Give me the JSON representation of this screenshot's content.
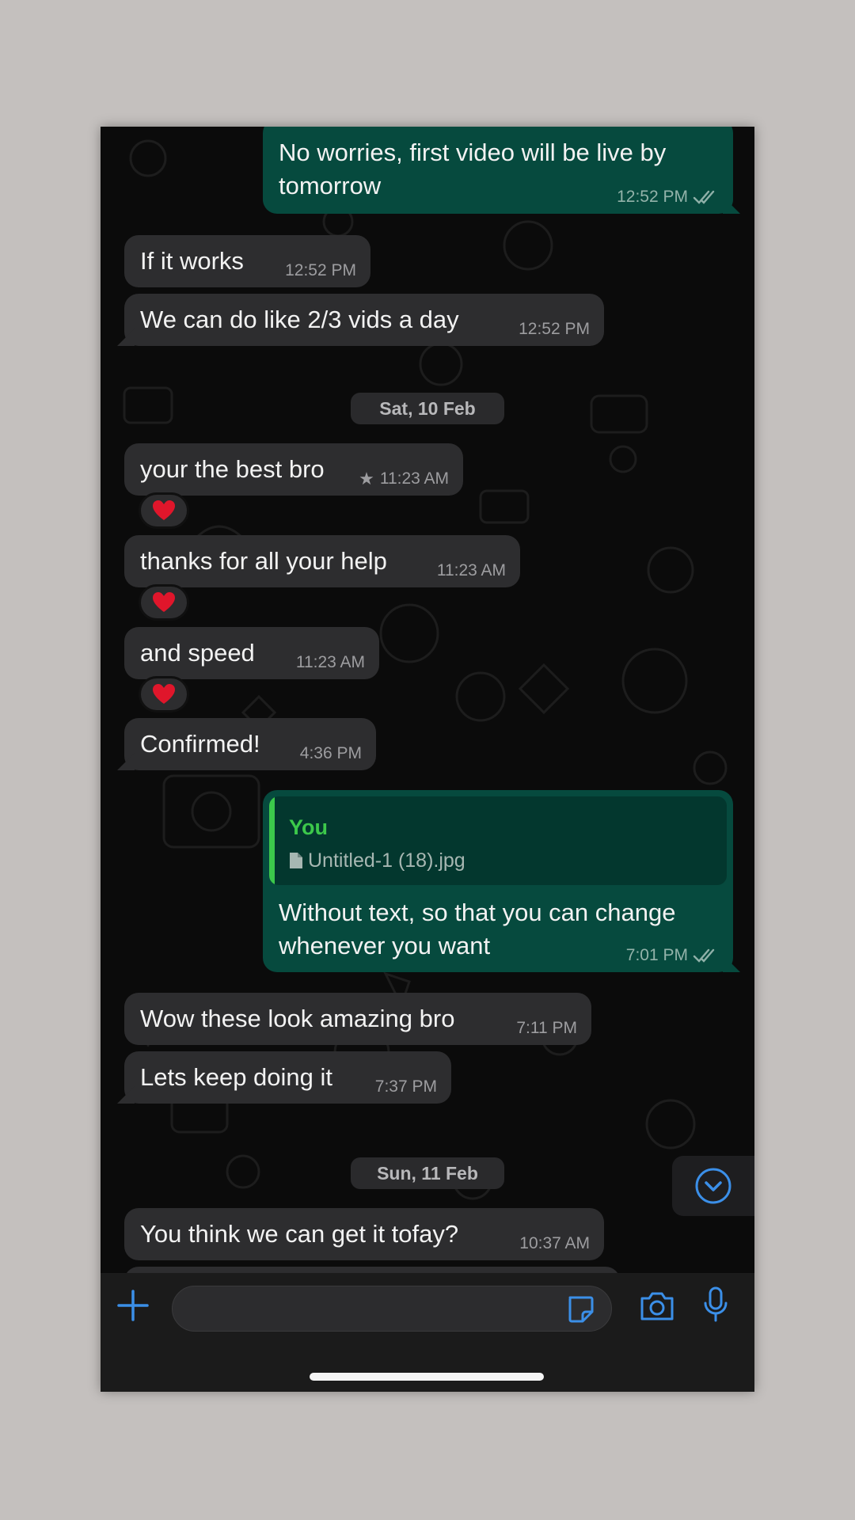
{
  "messages": [
    {
      "text": "No worries, first video will be live by tomorrow",
      "time": "12:52 PM"
    },
    {
      "text": "If it works",
      "time": "12:52 PM"
    },
    {
      "text": "We can do like 2/3 vids a day",
      "time": "12:52 PM"
    },
    {
      "text": "your the best bro",
      "time": "11:23 AM",
      "reaction": "❤️"
    },
    {
      "text": "thanks for all your help",
      "time": "11:23 AM",
      "reaction": "❤️"
    },
    {
      "text": "and speed",
      "time": "11:23 AM",
      "reaction": "❤️"
    },
    {
      "text": "Confirmed!",
      "time": "4:36 PM"
    },
    {
      "text": "Without text, so that you can change whenever you want",
      "time": "7:01 PM",
      "quote": {
        "author": "You",
        "file": "Untitled-1 (18).jpg"
      }
    },
    {
      "text": "Wow these look amazing bro",
      "time": "7:11 PM"
    },
    {
      "text": "Lets keep doing it",
      "time": "7:37 PM"
    },
    {
      "text": "You think we can get it tofay?",
      "time": "10:37 AM"
    }
  ],
  "date_chips": [
    "Sat, 10 Feb",
    "Sun, 11 Feb"
  ],
  "composer": {
    "placeholder": ""
  },
  "colors": {
    "incoming_bubble": "#2d2d2f",
    "outgoing_bubble": "#064a3e",
    "accent_blue": "#3b8fe8",
    "quote_author_green": "#3cc84b"
  },
  "icons": [
    "double-check-icon",
    "star-icon",
    "file-icon",
    "chevron-down-icon",
    "plus-icon",
    "sticker-icon",
    "camera-icon",
    "microphone-icon"
  ]
}
